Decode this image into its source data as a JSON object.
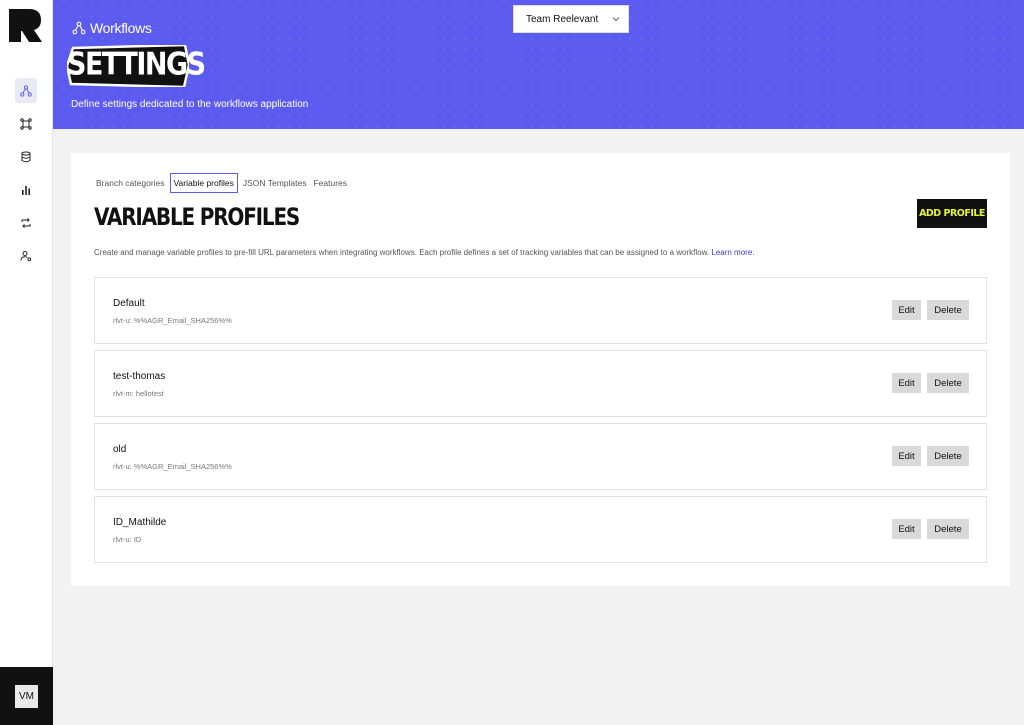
{
  "sidebar": {
    "nav": [
      {
        "icon": "workflows-icon",
        "active": true
      },
      {
        "icon": "integrations-icon",
        "active": false
      },
      {
        "icon": "database-icon",
        "active": false
      },
      {
        "icon": "analytics-icon",
        "active": false
      },
      {
        "icon": "sync-icon",
        "active": false
      },
      {
        "icon": "user-settings-icon",
        "active": false
      }
    ],
    "avatar_initials": "VM"
  },
  "header": {
    "app_name": "Workflows",
    "title": "SETTINGS",
    "subtitle": "Define settings dedicated to the workflows application",
    "team_select": "Team Reelevant"
  },
  "tabs": [
    "Branch categories",
    "Variable profiles",
    "JSON Templates",
    "Features"
  ],
  "active_tab": "Variable profiles",
  "section": {
    "title": "VARIABLE PROFILES",
    "add_button": "ADD PROFILE",
    "description": "Create and manage variable profiles to pre-fill URL parameters when integrating workflows. Each profile defines a set of tracking variables that can be assigned to a workflow.",
    "learn_more": "Learn more",
    "learn_more_suffix": "."
  },
  "profiles": [
    {
      "name": "Default",
      "vars": "rlvt-u: %%AGR_Email_SHA256%%"
    },
    {
      "name": "test-thomas",
      "vars": "rlvt-m: hellotest"
    },
    {
      "name": "old",
      "vars": "rlvt-u: %%AGR_Email_SHA256%%"
    },
    {
      "name": "ID_Mathilde",
      "vars": "rlvt-u: ID"
    }
  ],
  "buttons": {
    "edit": "Edit",
    "delete": "Delete"
  },
  "colors": {
    "accent": "#5b5bf0",
    "add_button_text": "#e6f43a",
    "dark": "#111111"
  }
}
